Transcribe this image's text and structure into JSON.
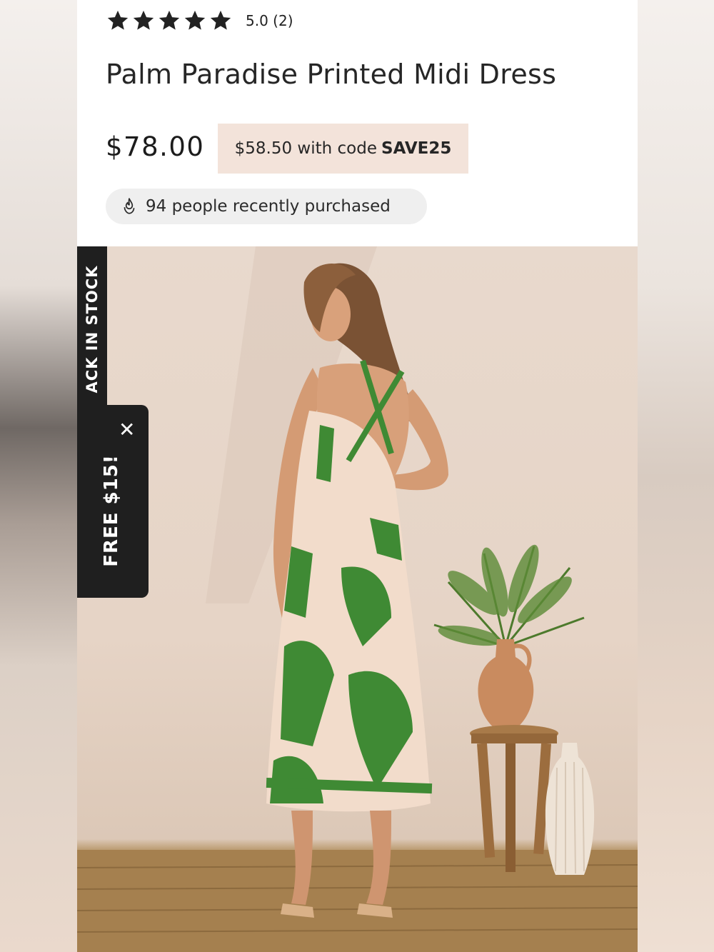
{
  "product": {
    "rating": {
      "stars": 5,
      "score_text": "5.0 (2)"
    },
    "title": "Palm Paradise Printed Midi Dress",
    "price": "$78.00",
    "promo": {
      "text": "$58.50 with code",
      "code": "SAVE25"
    },
    "social_proof": "94 people recently purchased"
  },
  "side_tabs": {
    "stock_tab": "ACK IN STOCK",
    "offer_tab": "FREE $15!",
    "close": "✕"
  },
  "colors": {
    "promo_bg": "#f3e3da",
    "pill_bg": "#efefef",
    "tab_bg": "#1f1f1f",
    "dress_green": "#3f8a34"
  }
}
